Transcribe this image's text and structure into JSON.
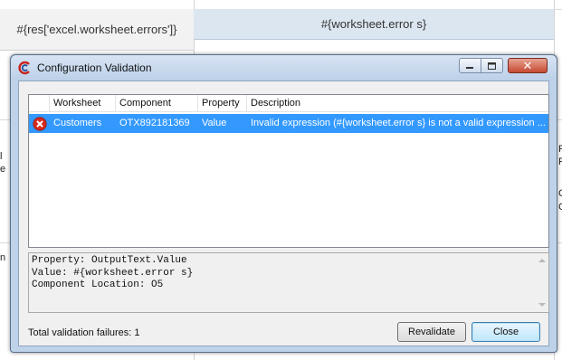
{
  "spreadsheet": {
    "cell_a1": "#{res['excel.worksheet.errors']}",
    "cell_b1": "#{worksheet.error s}",
    "left_fragments": [
      "l",
      "e",
      "n"
    ],
    "right_fragments": [
      "F",
      "F",
      "C",
      "C"
    ]
  },
  "dialog": {
    "title": "Configuration Validation",
    "icon": "app-logo-icon",
    "titlebar_buttons": {
      "minimize_icon": "minimize-icon",
      "maximize_icon": "maximize-icon",
      "close_label": "✕"
    },
    "grid": {
      "columns": [
        "Worksheet",
        "Component",
        "Property",
        "Description"
      ],
      "rows": [
        {
          "status_icon": "error-icon",
          "worksheet": "Customers",
          "component": "OTX892181369",
          "property": "Value",
          "description": "Invalid expression (#{worksheet.error s} is not a valid expression ..."
        }
      ],
      "selected_color": "#3399ff"
    },
    "details": {
      "lines": [
        "Property: OutputText.Value",
        "Value: #{worksheet.error s}",
        "Component Location: O5"
      ]
    },
    "footer": {
      "status": "Total validation failures: 1",
      "revalidate_label": "Revalidate",
      "close_label": "Close"
    }
  }
}
